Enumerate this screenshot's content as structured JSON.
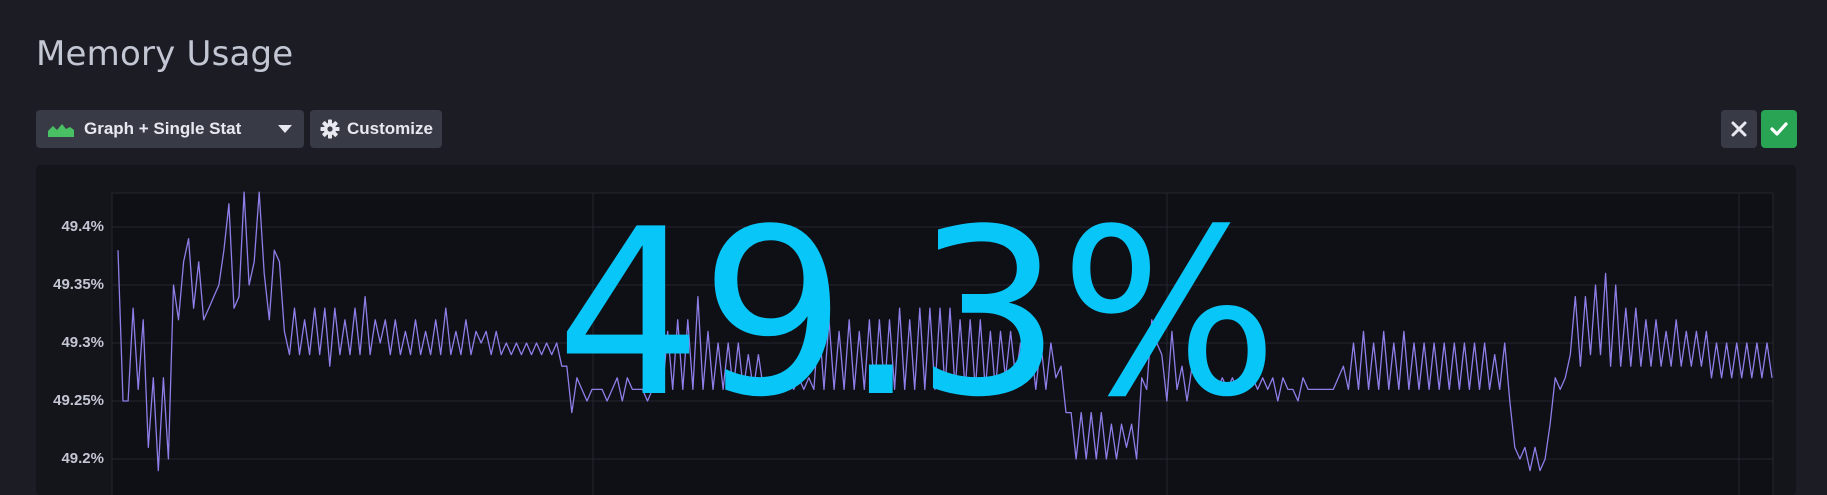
{
  "title": "Memory Usage",
  "toolbar": {
    "viz_type_label": "Graph + Single Stat",
    "customize_label": "Customize"
  },
  "colors": {
    "stat": "#09c6f8",
    "line": "#8f7de8",
    "confirm": "#28a454"
  },
  "single_stat": "49.3%",
  "chart_data": {
    "type": "line",
    "y_ticks": [
      "49.4%",
      "49.35%",
      "49.3%",
      "49.25%",
      "49.2%"
    ],
    "ylim": [
      49.19,
      49.43
    ],
    "grid": true,
    "series": [
      {
        "values": [
          49.38,
          49.25,
          49.25,
          49.33,
          49.26,
          49.32,
          49.21,
          49.27,
          49.19,
          49.27,
          49.2,
          49.35,
          49.32,
          49.37,
          49.39,
          49.33,
          49.37,
          49.32,
          49.33,
          49.34,
          49.35,
          49.38,
          49.42,
          49.33,
          49.34,
          49.43,
          49.35,
          49.37,
          49.43,
          49.36,
          49.32,
          49.38,
          49.37,
          49.31,
          49.29,
          49.33,
          49.29,
          49.32,
          49.29,
          49.33,
          49.29,
          49.33,
          49.28,
          49.33,
          49.29,
          49.32,
          49.29,
          49.33,
          49.29,
          49.34,
          49.29,
          49.32,
          49.3,
          49.32,
          49.29,
          49.32,
          49.29,
          49.31,
          49.29,
          49.32,
          49.29,
          49.31,
          49.29,
          49.32,
          49.29,
          49.33,
          49.29,
          49.31,
          49.29,
          49.32,
          49.29,
          49.31,
          49.3,
          49.31,
          49.29,
          49.31,
          49.29,
          49.3,
          49.29,
          49.3,
          49.29,
          49.3,
          49.29,
          49.3,
          49.29,
          49.3,
          49.29,
          49.3,
          49.28,
          49.28,
          49.24,
          49.27,
          49.26,
          49.25,
          49.26,
          49.26,
          49.26,
          49.25,
          49.26,
          49.27,
          49.25,
          49.27,
          49.26,
          49.26,
          49.26,
          49.25,
          49.26,
          49.27,
          49.26,
          49.31,
          49.26,
          49.32,
          49.26,
          49.32,
          49.26,
          49.34,
          49.26,
          49.31,
          49.26,
          49.3,
          49.26,
          49.3,
          49.26,
          49.3,
          49.26,
          49.29,
          49.26,
          49.29,
          49.26,
          49.27,
          49.26,
          49.27,
          49.26,
          49.27,
          49.26,
          49.27,
          49.26,
          49.27,
          49.26,
          49.32,
          49.26,
          49.32,
          49.26,
          49.31,
          49.26,
          49.32,
          49.26,
          49.31,
          49.26,
          49.32,
          49.26,
          49.32,
          49.26,
          49.32,
          49.26,
          49.33,
          49.26,
          49.32,
          49.26,
          49.33,
          49.26,
          49.33,
          49.26,
          49.33,
          49.26,
          49.33,
          49.26,
          49.32,
          49.26,
          49.32,
          49.26,
          49.32,
          49.26,
          49.31,
          49.26,
          49.31,
          49.27,
          49.31,
          49.27,
          49.3,
          49.27,
          49.3,
          49.26,
          49.3,
          49.26,
          49.3,
          49.27,
          49.28,
          49.24,
          49.24,
          49.2,
          49.24,
          49.2,
          49.24,
          49.2,
          49.24,
          49.2,
          49.23,
          49.2,
          49.23,
          49.21,
          49.23,
          49.2,
          49.27,
          49.26,
          49.32,
          49.3,
          49.29,
          49.25,
          49.31,
          49.26,
          49.28,
          49.25,
          49.28,
          49.27,
          49.28,
          49.27,
          49.27,
          49.26,
          49.27,
          49.26,
          49.27,
          49.26,
          49.27,
          49.27,
          49.27,
          49.26,
          49.27,
          49.26,
          49.27,
          49.25,
          49.27,
          49.26,
          49.26,
          49.25,
          49.27,
          49.26,
          49.26,
          49.26,
          49.26,
          49.26,
          49.26,
          49.27,
          49.28,
          49.26,
          49.3,
          49.26,
          49.31,
          49.26,
          49.3,
          49.26,
          49.31,
          49.26,
          49.3,
          49.26,
          49.31,
          49.26,
          49.3,
          49.26,
          49.3,
          49.26,
          49.3,
          49.26,
          49.3,
          49.26,
          49.3,
          49.26,
          49.3,
          49.26,
          49.3,
          49.26,
          49.3,
          49.26,
          49.29,
          49.26,
          49.3,
          49.25,
          49.21,
          49.2,
          49.21,
          49.19,
          49.21,
          49.19,
          49.2,
          49.23,
          49.27,
          49.26,
          49.27,
          49.29,
          49.34,
          49.28,
          49.34,
          49.29,
          49.35,
          49.29,
          49.36,
          49.28,
          49.35,
          49.28,
          49.33,
          49.28,
          49.33,
          49.28,
          49.32,
          49.28,
          49.32,
          49.28,
          49.31,
          49.28,
          49.32,
          49.28,
          49.31,
          49.28,
          49.31,
          49.28,
          49.31,
          49.27,
          49.3,
          49.27,
          49.3,
          49.27,
          49.3,
          49.27,
          49.3,
          49.27,
          49.3,
          49.27,
          49.3,
          49.27
        ]
      }
    ]
  }
}
